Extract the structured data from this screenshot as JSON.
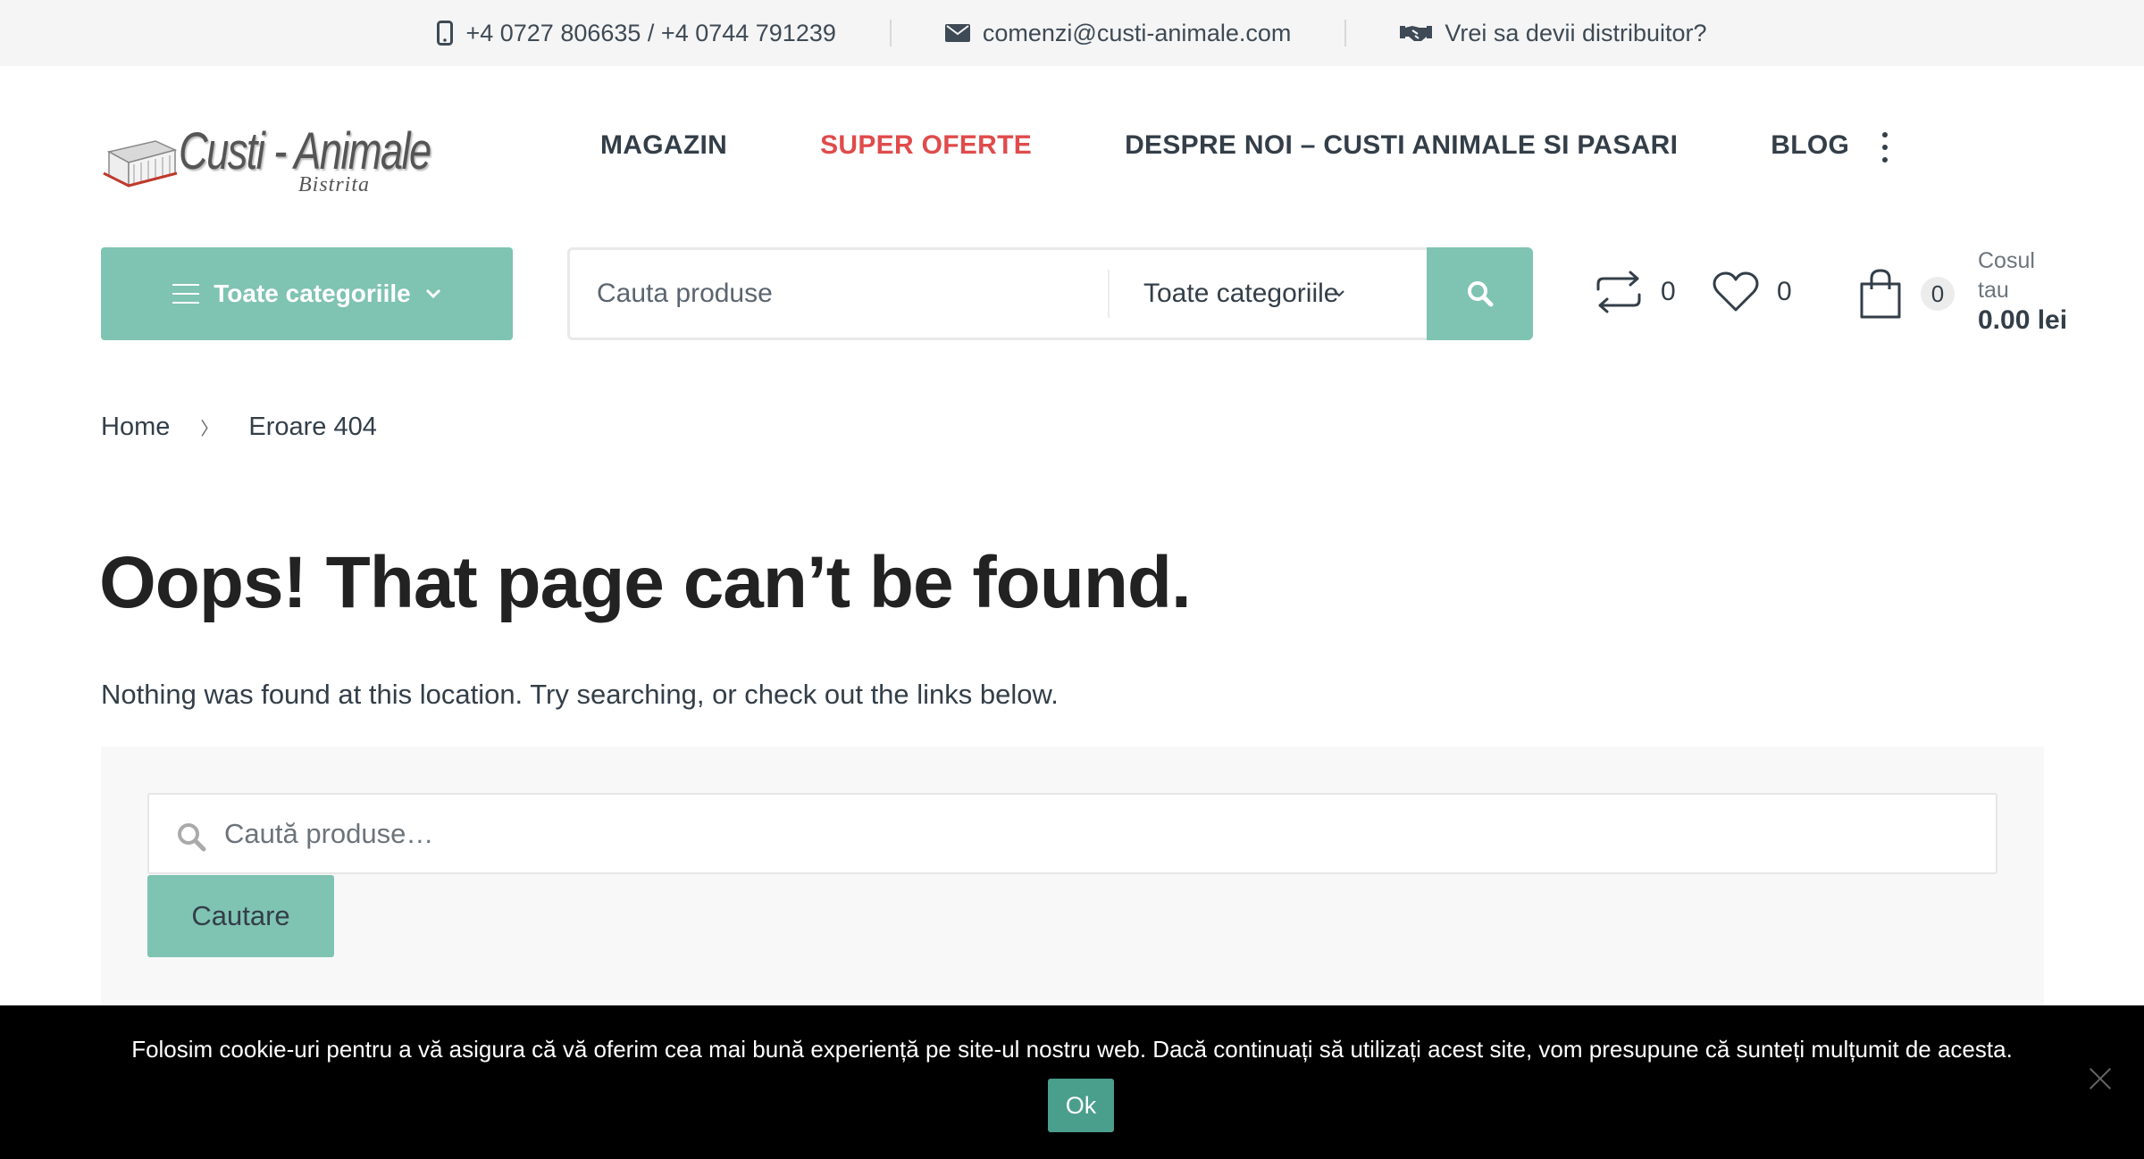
{
  "topbar": {
    "phone": "+4 0727 806635 / +4 0744 791239",
    "email": "comenzi@custi-animale.com",
    "distributor": "Vrei sa devii distribuitor?"
  },
  "logo": {
    "main": "Custi - Animale",
    "sub": "Bistrita"
  },
  "nav": {
    "items": [
      {
        "label": "MAGAZIN"
      },
      {
        "label": "SUPER OFERTE"
      },
      {
        "label": "DESPRE NOI – CUSTI ANIMALE SI PASARI"
      },
      {
        "label": "BLOG"
      }
    ]
  },
  "categories_button": {
    "label": "Toate categoriile"
  },
  "search": {
    "placeholder": "Cauta produse",
    "category": "Toate categoriile"
  },
  "header_counts": {
    "compare": "0",
    "wishlist": "0",
    "cart": "0"
  },
  "cart": {
    "label_line1": "Cosul",
    "label_line2": "tau",
    "total": "0.00 lei"
  },
  "breadcrumb": {
    "home": "Home",
    "current": "Eroare 404"
  },
  "content": {
    "title": "Oops! That page can’t be found.",
    "description": "Nothing was found at this location. Try searching, or check out the links below.",
    "search_placeholder": "Caută produse…",
    "search_button": "Cautare"
  },
  "cookie": {
    "text": "Folosim cookie-uri pentru a vă asigura că vă oferim cea mai bună experiență pe site-ul nostru web. Dacă continuați să utilizați acest site, vom presupune că sunteți mulțumit de acesta.",
    "ok": "Ok"
  },
  "colors": {
    "accent": "#7fc3b2",
    "hot": "#e04b4b",
    "text": "#333e48"
  },
  "icons": [
    "phone-icon",
    "envelope-icon",
    "handshake-icon",
    "menu-icon",
    "chevron-down-icon",
    "search-icon",
    "compare-icon",
    "heart-icon",
    "shopping-bag-icon",
    "more-icon",
    "close-icon"
  ]
}
